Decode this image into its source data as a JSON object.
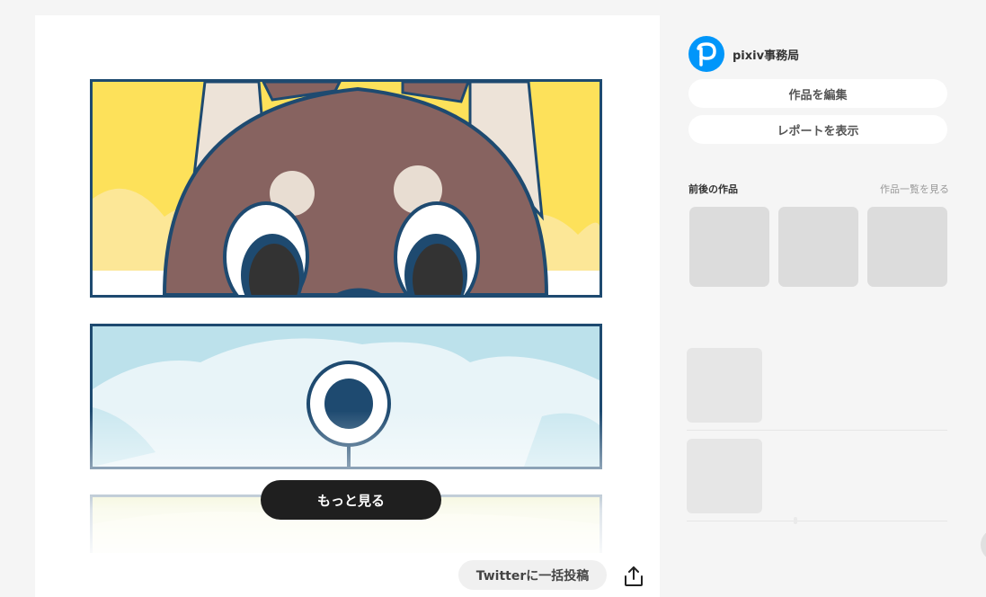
{
  "artwork": {
    "more_button_label": "もっと見る",
    "tweet_button_label": "Twitterに一括投稿",
    "share_icon": "share-upload-icon"
  },
  "sidebar": {
    "author_name": "pixiv事務局",
    "avatar_icon": "pixiv-logo-icon",
    "edit_button_label": "作品を編集",
    "report_button_label": "レポートを表示",
    "related_title": "前後の作品",
    "related_link": "作品一覧を見る"
  },
  "colors": {
    "accent": "#0096fa",
    "panel_border": "#1e4a70",
    "dark_button": "#1f1f1f"
  }
}
